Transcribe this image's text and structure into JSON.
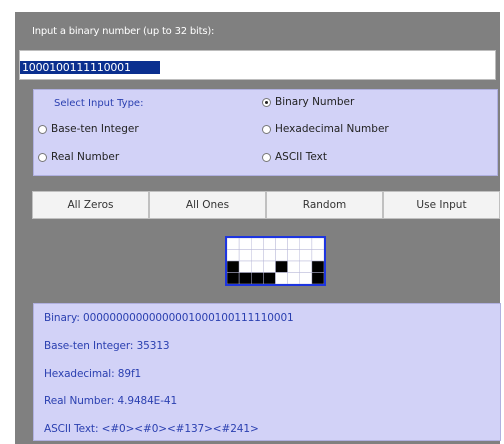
{
  "prompt": "Input a binary number (up to 32 bits):",
  "input": {
    "value": "1000100111110001"
  },
  "input_type": {
    "label": "Select Input Type:",
    "options": [
      {
        "label": "Binary Number",
        "checked": true
      },
      {
        "label": "Base-ten Integer",
        "checked": false
      },
      {
        "label": "Hexadecimal Number",
        "checked": false
      },
      {
        "label": "Real Number",
        "checked": false
      },
      {
        "label": "ASCII Text",
        "checked": false
      }
    ]
  },
  "buttons": {
    "all_zeros": "All Zeros",
    "all_ones": "All Ones",
    "random": "Random",
    "use_input": "Use Input"
  },
  "bitmap": {
    "rows": 4,
    "cols": 8,
    "bits": "00000000000000001000100111110001"
  },
  "results": {
    "binary": "Binary: 00000000000000001000100111110001",
    "base_ten": "Base-ten Integer: 35313",
    "hex": "Hexadecimal: 89f1",
    "real": "Real Number: 4.9484E-41",
    "ascii": "ASCII Text: <#0><#0><#137><#241>"
  },
  "colors": {
    "accent": "#1d35e0",
    "panel": "#808080",
    "box": "#d2d2f7"
  }
}
